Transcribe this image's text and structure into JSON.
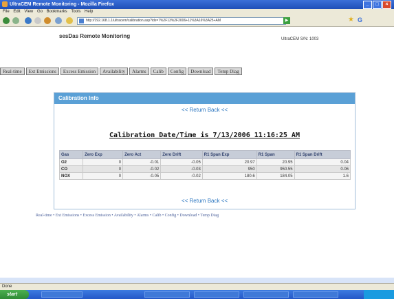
{
  "window": {
    "title": "UltraCEM Remote Monitoring - Mozilla Firefox"
  },
  "menu": [
    "File",
    "Edit",
    "View",
    "Go",
    "Bookmarks",
    "Tools",
    "Help"
  ],
  "toolbar": {
    "address": "http://192.168.1.1/ultracem/calibration.asp?idx=7%2F13%2F2006+11%3A16%3A25+AM"
  },
  "header": {
    "title": "sesDas Remote Monitoring",
    "subtitle": "UltraCEM S/N: 1003"
  },
  "nav": [
    "Real-time",
    "Ext Emissions",
    "Excess Emission",
    "Availability",
    "Alarms",
    "Calib",
    "Config",
    "Download",
    "Temp Diag"
  ],
  "panel": {
    "title": "Calibration Info",
    "return_top": "<< Return Back <<",
    "cal_title": "Calibration Date/Time is 7/13/2006 11:16:25 AM",
    "return_bottom": "<< Return Back <<"
  },
  "table": {
    "headers": [
      "Gas",
      "Zero Exp",
      "Zero Act",
      "Zero Drift",
      "R1 Span Exp",
      "R1 Span",
      "R1 Span Drift"
    ],
    "rows": [
      [
        "O2",
        "0",
        "-0.01",
        "-0.05",
        "20.97",
        "20.95",
        "0.04"
      ],
      [
        "CO",
        "0",
        "-0.02",
        "-0.03",
        "950",
        "950.55",
        "0.06"
      ],
      [
        "NOX",
        "0",
        "-0.05",
        "-0.02",
        "180.6",
        "184.05",
        "1.6"
      ]
    ]
  },
  "footer": [
    "Real-time",
    "Ext Emissions",
    "Excess Emission",
    "Availability",
    "Alarms",
    "Calib",
    "Config",
    "Download",
    "Temp Diag"
  ],
  "status": {
    "text": "Done"
  },
  "taskbar": {
    "start": "start"
  }
}
